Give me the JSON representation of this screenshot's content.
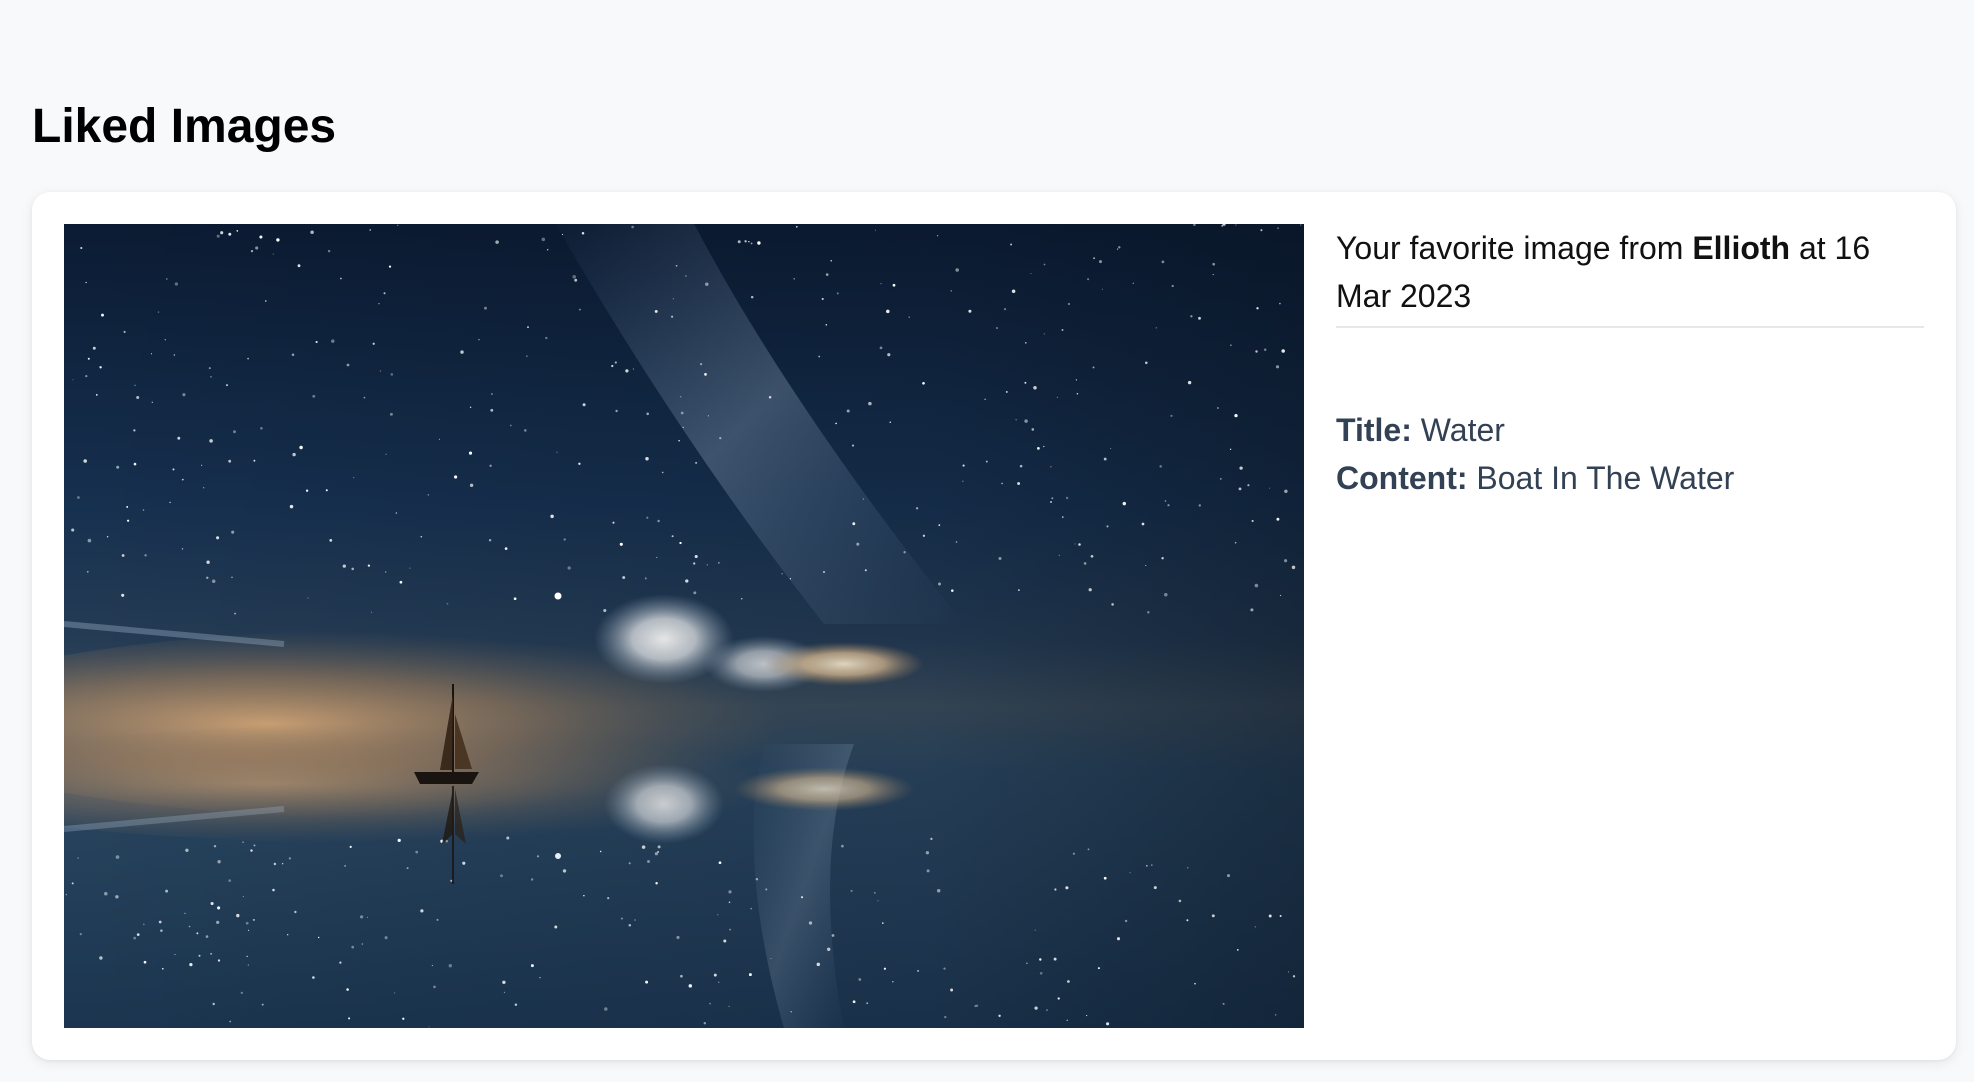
{
  "page": {
    "title": "Liked Images"
  },
  "card": {
    "favorite_prefix": "Your favorite image from",
    "author": "Ellioth",
    "date_prefix": "at",
    "date": "16 Mar 2023",
    "title_label": "Title:",
    "title_value": "Water",
    "content_label": "Content:",
    "content_value": "Boat In The Water",
    "image_subject": "sailboat-night-sky-reflection"
  }
}
